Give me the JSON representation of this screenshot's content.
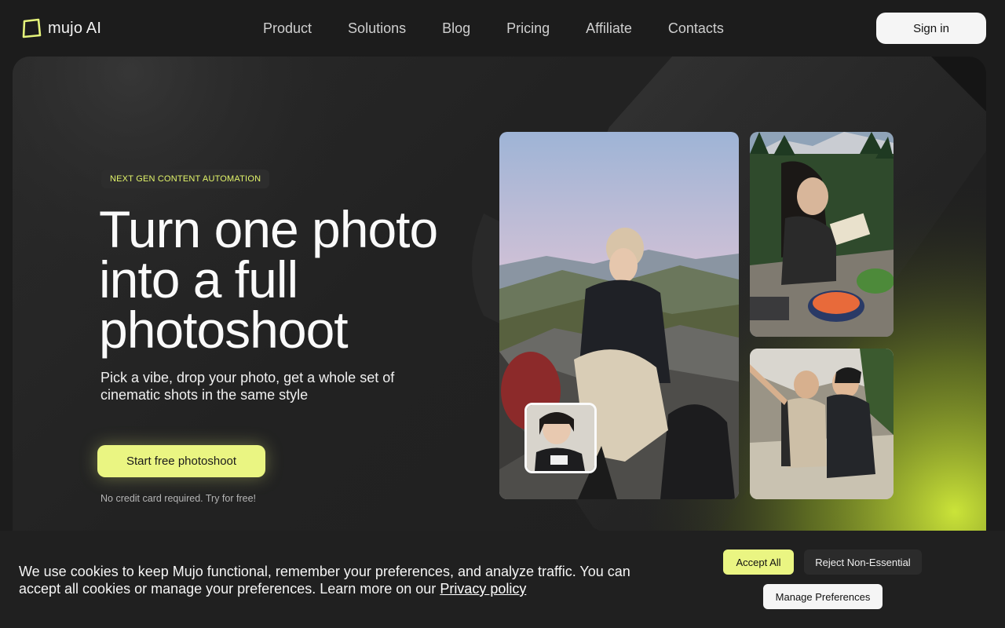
{
  "brand": {
    "name": "mujo AI",
    "accent_color": "#eaf582",
    "logo_icon": "square-frame-icon"
  },
  "nav": {
    "items": [
      {
        "label": "Product"
      },
      {
        "label": "Solutions"
      },
      {
        "label": "Blog"
      },
      {
        "label": "Pricing"
      },
      {
        "label": "Affiliate"
      },
      {
        "label": "Contacts"
      }
    ],
    "sign_in_label": "Sign in"
  },
  "hero": {
    "badge": "NEXT GEN CONTENT AUTOMATION",
    "headline": "Turn one photo into a full photoshoot",
    "subtext": "Pick a vibe, drop your photo, get a whole set of cinematic shots in the same style",
    "cta_label": "Start free photoshoot",
    "cta_note": "No credit card required. Try for free!"
  },
  "cookie_banner": {
    "text": "We use cookies to keep Mujo functional, remember your preferences, and analyze traffic. You can accept all cookies or manage your preferences. Learn more on our",
    "link_label": "Privacy policy",
    "accept_label": "Accept All",
    "reject_label": "Reject Non-Essential",
    "manage_label": "Manage Preferences"
  }
}
